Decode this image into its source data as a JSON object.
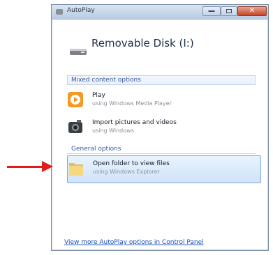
{
  "window": {
    "title": "AutoPlay"
  },
  "drive": {
    "title": "Removable Disk (I:)"
  },
  "sections": {
    "mixed": {
      "header": "Mixed content options"
    },
    "general": {
      "header": "General options"
    }
  },
  "options": [
    {
      "title": "Play",
      "subtitle": "using Windows Media Player"
    },
    {
      "title": "Import pictures and videos",
      "subtitle": "using Windows"
    }
  ],
  "general_options": [
    {
      "title": "Open folder to view files",
      "subtitle": "using Windows Explorer"
    }
  ],
  "footer": {
    "link": "View more AutoPlay options in Control Panel"
  },
  "colors": {
    "selected_border": "#84a7d6",
    "arrow": "#e21b1b",
    "link": "#1a4fb6"
  }
}
